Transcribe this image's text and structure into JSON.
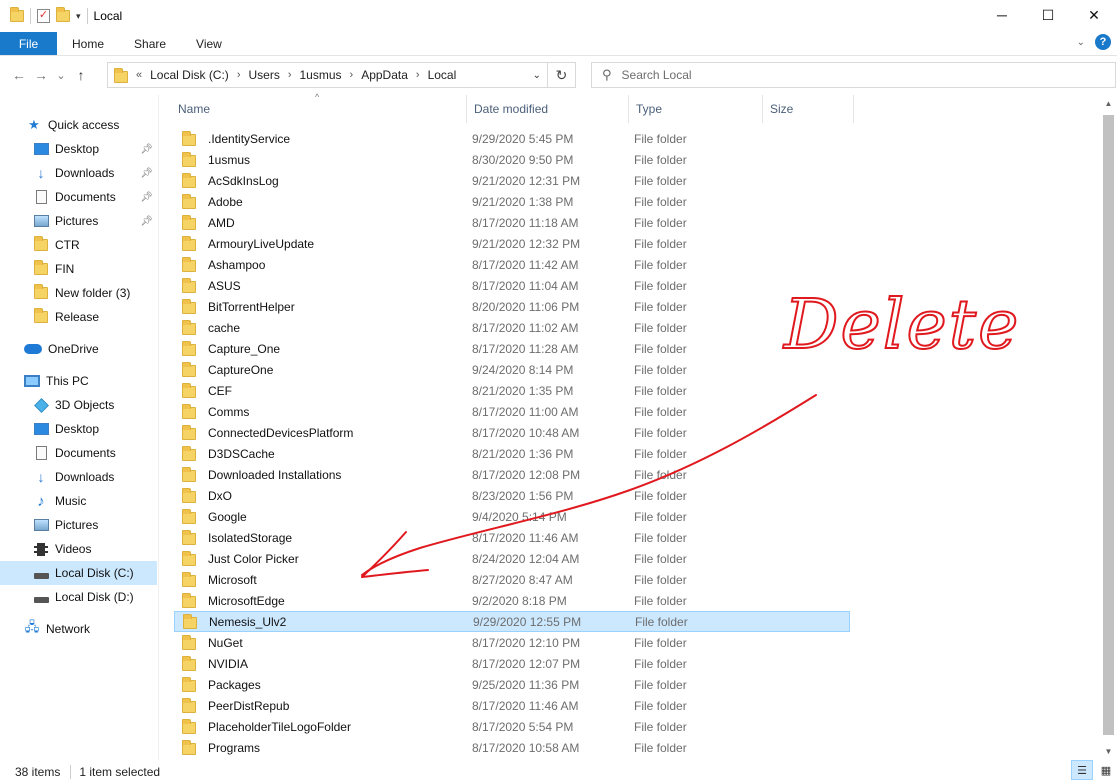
{
  "window": {
    "title": "Local",
    "minimize_icon": "─",
    "maximize_icon": "☐",
    "close_icon": "✕"
  },
  "ribbon": {
    "tabs": [
      {
        "label": "File"
      },
      {
        "label": "Home"
      },
      {
        "label": "Share"
      },
      {
        "label": "View"
      }
    ],
    "help_icon": "?"
  },
  "nav": {
    "back_icon": "←",
    "forward_icon": "→",
    "recent_icon": "⌄",
    "up_icon": "↑",
    "overflow": "«",
    "breadcrumb": [
      "Local Disk (C:)",
      "Users",
      "1usmus",
      "AppData",
      "Local"
    ],
    "refresh_icon": "↻"
  },
  "search": {
    "placeholder": "Search Local"
  },
  "sidebar": {
    "items": [
      {
        "label": "Quick access",
        "icon": "star-icon"
      },
      {
        "label": "Desktop",
        "icon": "desktop-icon",
        "pinned": true
      },
      {
        "label": "Downloads",
        "icon": "downloads-icon",
        "pinned": true
      },
      {
        "label": "Documents",
        "icon": "documents-icon",
        "pinned": true
      },
      {
        "label": "Pictures",
        "icon": "pictures-icon",
        "pinned": true
      },
      {
        "label": "CTR",
        "icon": "folder-icon"
      },
      {
        "label": "FIN",
        "icon": "folder-icon"
      },
      {
        "label": "New folder (3)",
        "icon": "folder-icon"
      },
      {
        "label": "Release",
        "icon": "folder-icon"
      },
      {
        "label": "OneDrive",
        "icon": "cloud-icon"
      },
      {
        "label": "This PC",
        "icon": "pc-icon"
      },
      {
        "label": "3D Objects",
        "icon": "3d-objects-icon"
      },
      {
        "label": "Desktop",
        "icon": "desktop-icon"
      },
      {
        "label": "Documents",
        "icon": "documents-icon"
      },
      {
        "label": "Downloads",
        "icon": "downloads-icon"
      },
      {
        "label": "Music",
        "icon": "music-icon"
      },
      {
        "label": "Pictures",
        "icon": "pictures-icon"
      },
      {
        "label": "Videos",
        "icon": "videos-icon"
      },
      {
        "label": "Local Disk (C:)",
        "icon": "drive-icon",
        "selected": true
      },
      {
        "label": "Local Disk (D:)",
        "icon": "drive-icon"
      },
      {
        "label": "Network",
        "icon": "network-icon"
      }
    ]
  },
  "columns": {
    "name": "Name",
    "date": "Date modified",
    "type": "Type",
    "size": "Size"
  },
  "files": [
    {
      "name": ".IdentityService",
      "date": "9/29/2020 5:45 PM",
      "type": "File folder"
    },
    {
      "name": "1usmus",
      "date": "8/30/2020 9:50 PM",
      "type": "File folder"
    },
    {
      "name": "AcSdkInsLog",
      "date": "9/21/2020 12:31 PM",
      "type": "File folder"
    },
    {
      "name": "Adobe",
      "date": "9/21/2020 1:38 PM",
      "type": "File folder"
    },
    {
      "name": "AMD",
      "date": "8/17/2020 11:18 AM",
      "type": "File folder"
    },
    {
      "name": "ArmouryLiveUpdate",
      "date": "9/21/2020 12:32 PM",
      "type": "File folder"
    },
    {
      "name": "Ashampoo",
      "date": "8/17/2020 11:42 AM",
      "type": "File folder"
    },
    {
      "name": "ASUS",
      "date": "8/17/2020 11:04 AM",
      "type": "File folder"
    },
    {
      "name": "BitTorrentHelper",
      "date": "8/20/2020 11:06 PM",
      "type": "File folder"
    },
    {
      "name": "cache",
      "date": "8/17/2020 11:02 AM",
      "type": "File folder"
    },
    {
      "name": "Capture_One",
      "date": "8/17/2020 11:28 AM",
      "type": "File folder"
    },
    {
      "name": "CaptureOne",
      "date": "9/24/2020 8:14 PM",
      "type": "File folder"
    },
    {
      "name": "CEF",
      "date": "8/21/2020 1:35 PM",
      "type": "File folder"
    },
    {
      "name": "Comms",
      "date": "8/17/2020 11:00 AM",
      "type": "File folder"
    },
    {
      "name": "ConnectedDevicesPlatform",
      "date": "8/17/2020 10:48 AM",
      "type": "File folder"
    },
    {
      "name": "D3DSCache",
      "date": "8/21/2020 1:36 PM",
      "type": "File folder"
    },
    {
      "name": "Downloaded Installations",
      "date": "8/17/2020 12:08 PM",
      "type": "File folder"
    },
    {
      "name": "DxO",
      "date": "8/23/2020 1:56 PM",
      "type": "File folder"
    },
    {
      "name": "Google",
      "date": "9/4/2020 5:14 PM",
      "type": "File folder"
    },
    {
      "name": "IsolatedStorage",
      "date": "8/17/2020 11:46 AM",
      "type": "File folder"
    },
    {
      "name": "Just Color Picker",
      "date": "8/24/2020 12:04 AM",
      "type": "File folder"
    },
    {
      "name": "Microsoft",
      "date": "8/27/2020 8:47 AM",
      "type": "File folder"
    },
    {
      "name": "MicrosoftEdge",
      "date": "9/2/2020 8:18 PM",
      "type": "File folder"
    },
    {
      "name": "Nemesis_Ulv2",
      "date": "9/29/2020 12:55 PM",
      "type": "File folder",
      "selected": true
    },
    {
      "name": "NuGet",
      "date": "8/17/2020 12:10 PM",
      "type": "File folder"
    },
    {
      "name": "NVIDIA",
      "date": "8/17/2020 12:07 PM",
      "type": "File folder"
    },
    {
      "name": "Packages",
      "date": "9/25/2020 11:36 PM",
      "type": "File folder"
    },
    {
      "name": "PeerDistRepub",
      "date": "8/17/2020 11:46 AM",
      "type": "File folder"
    },
    {
      "name": "PlaceholderTileLogoFolder",
      "date": "8/17/2020 5:54 PM",
      "type": "File folder"
    },
    {
      "name": "Programs",
      "date": "8/17/2020 10:58 AM",
      "type": "File folder"
    }
  ],
  "status": {
    "count": "38 items",
    "selection": "1 item selected"
  },
  "annotation": {
    "text": "Delete",
    "color": "#e0191f"
  },
  "colors": {
    "accent": "#1979ca",
    "selection": "#cce8ff",
    "folder": "#f6d365"
  }
}
